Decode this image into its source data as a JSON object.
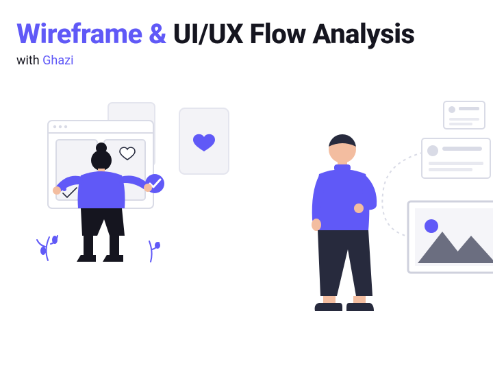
{
  "title": {
    "accent": "Wireframe &",
    "dark": "UI/UX Flow Analysis"
  },
  "subtitle": {
    "prefix": "with ",
    "name": "Ghazi"
  },
  "colors": {
    "accent": "#6059F7",
    "dark": "#15151f",
    "boardStroke": "#d9dbe6",
    "boardFill": "#f3f3f7",
    "skin": "#f3bda0",
    "pants": "#272a3d",
    "gray": "#c8cad5"
  }
}
